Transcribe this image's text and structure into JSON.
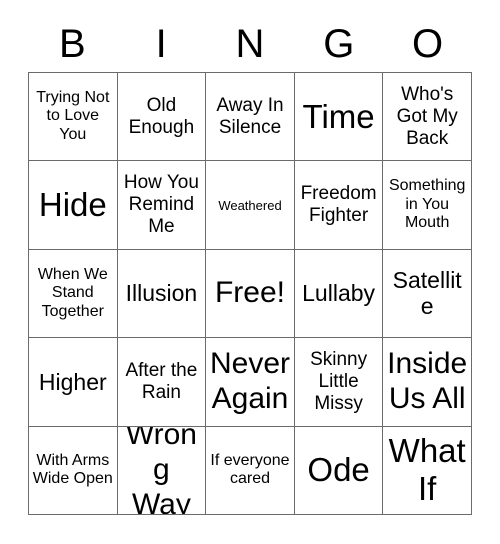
{
  "card": {
    "title": "BINGO Card",
    "header_letters": [
      "B",
      "I",
      "N",
      "G",
      "O"
    ],
    "grid_line_color": "#6b6b6b",
    "background_color": "#ffffff",
    "text_color": "#000000",
    "rows": 5,
    "columns": 5,
    "free_space": "Free!",
    "cells": [
      [
        {
          "text": "Trying Not to Love You",
          "size": "sm"
        },
        {
          "text": "Old Enough",
          "size": "md"
        },
        {
          "text": "Away In Silence",
          "size": "md"
        },
        {
          "text": "Time",
          "size": "xxl"
        },
        {
          "text": "Who's Got My Back",
          "size": "md"
        }
      ],
      [
        {
          "text": "Hide",
          "size": "xxl"
        },
        {
          "text": "How You Remind Me",
          "size": "md"
        },
        {
          "text": "Weathered",
          "size": "xs"
        },
        {
          "text": "Freedom Fighter",
          "size": "md"
        },
        {
          "text": "Something in You Mouth",
          "size": "sm"
        }
      ],
      [
        {
          "text": "When We Stand Together",
          "size": "sm"
        },
        {
          "text": "Illusion",
          "size": "lg"
        },
        {
          "text": "Free!",
          "size": "xl"
        },
        {
          "text": "Lullaby",
          "size": "lg"
        },
        {
          "text": "Satellite",
          "size": "lg"
        }
      ],
      [
        {
          "text": "Higher",
          "size": "lg"
        },
        {
          "text": "After the Rain",
          "size": "md"
        },
        {
          "text": "Never Again",
          "size": "xl"
        },
        {
          "text": "Skinny Little Missy",
          "size": "md"
        },
        {
          "text": "Inside Us All",
          "size": "xl"
        }
      ],
      [
        {
          "text": "With Arms Wide Open",
          "size": "sm"
        },
        {
          "text": "Wrong Way",
          "size": "xl"
        },
        {
          "text": "If everyone cared",
          "size": "sm"
        },
        {
          "text": "Ode",
          "size": "xxl"
        },
        {
          "text": "What If",
          "size": "xxl"
        }
      ]
    ]
  }
}
